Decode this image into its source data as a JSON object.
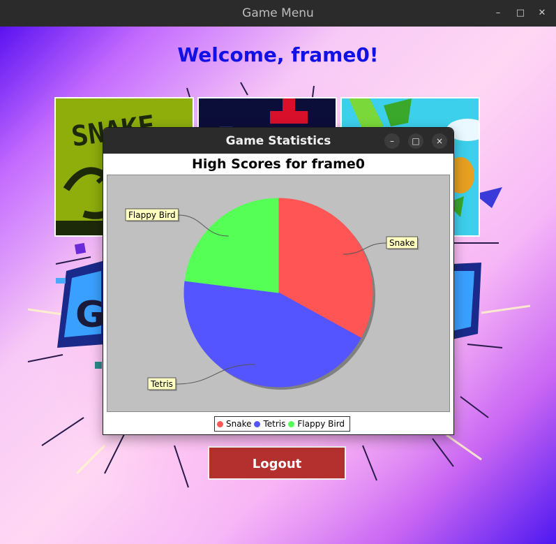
{
  "window": {
    "title": "Game Menu",
    "minimize_icon": "minimize-icon",
    "maximize_icon": "maximize-icon",
    "close_icon": "close-icon"
  },
  "main": {
    "welcome": "Welcome, frame0!",
    "tiles": [
      {
        "name": "Snake",
        "text": "SNAKE"
      },
      {
        "name": "Tetris"
      },
      {
        "name": "Flappy Bird"
      }
    ],
    "logout_label": "Logout"
  },
  "dialog": {
    "title": "Game Statistics",
    "minimize_label": "–",
    "maximize_label": "□",
    "close_label": "×"
  },
  "chart_data": {
    "type": "pie",
    "title": "High Scores for frame0",
    "slices": [
      {
        "label": "Snake",
        "value": 33,
        "color": "#ff5555"
      },
      {
        "label": "Tetris",
        "value": 44,
        "color": "#5555ff"
      },
      {
        "label": "Flappy Bird",
        "value": 23,
        "color": "#55ff55"
      }
    ],
    "background": "#c0c0c0",
    "legend": "bottom"
  },
  "colors": {
    "welcome": "#1111e6",
    "logout_bg": "#b3302e",
    "titlebar": "#2b2b2b"
  }
}
